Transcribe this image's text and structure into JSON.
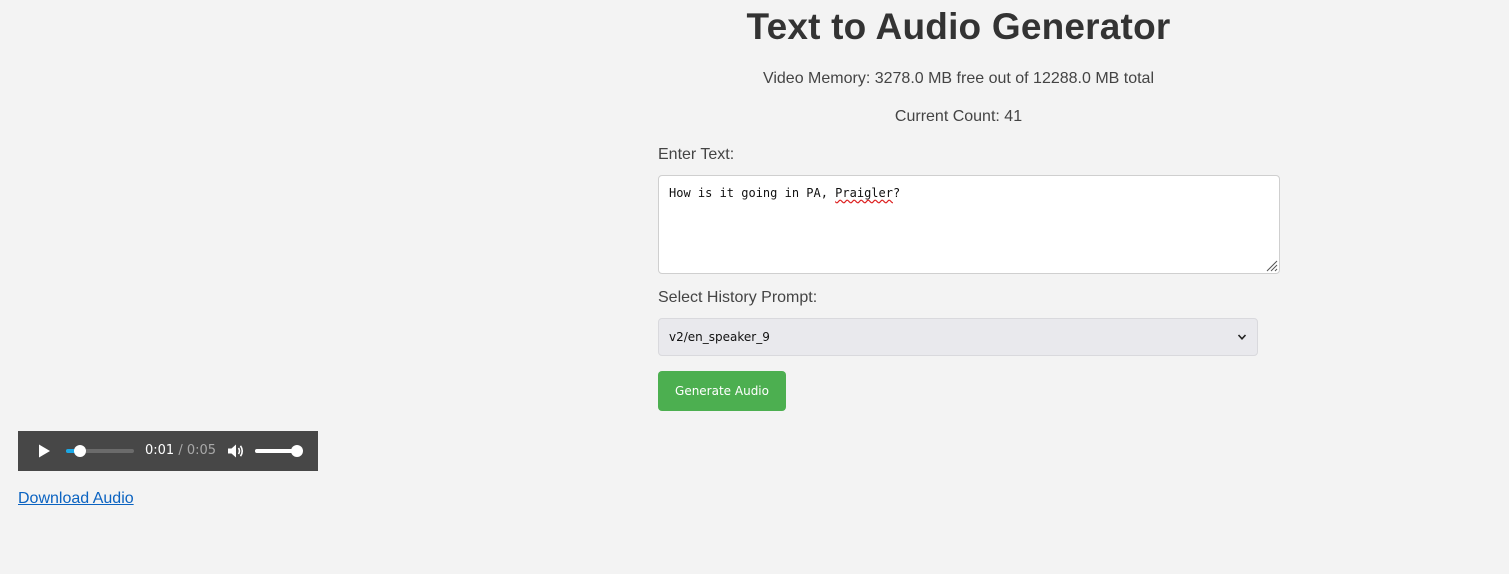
{
  "page": {
    "title": "Text to Audio Generator",
    "video_memory": "Video Memory: 3278.0 MB free out of 12288.0 MB total",
    "current_count": "Current Count: 41"
  },
  "form": {
    "text_label": "Enter Text:",
    "text_value_before": "How is it going in PA, ",
    "text_value_misspelled": "Praigler",
    "text_value_after": "?",
    "history_label": "Select History Prompt:",
    "history_selected": "v2/en_speaker_9",
    "generate_label": "Generate Audio"
  },
  "player": {
    "current_time": "0:01",
    "separator": " / ",
    "duration": "0:05",
    "progress_fraction": 0.2,
    "volume_fraction": 1.0,
    "accent_color": "#1aa8e6",
    "icons": {
      "play": "play-icon",
      "volume": "volume-icon"
    }
  },
  "download_label": "Download Audio",
  "colors": {
    "background": "#f3f3f3",
    "button": "#4caf50",
    "link": "#0b63c1",
    "player_bg": "#474747"
  }
}
